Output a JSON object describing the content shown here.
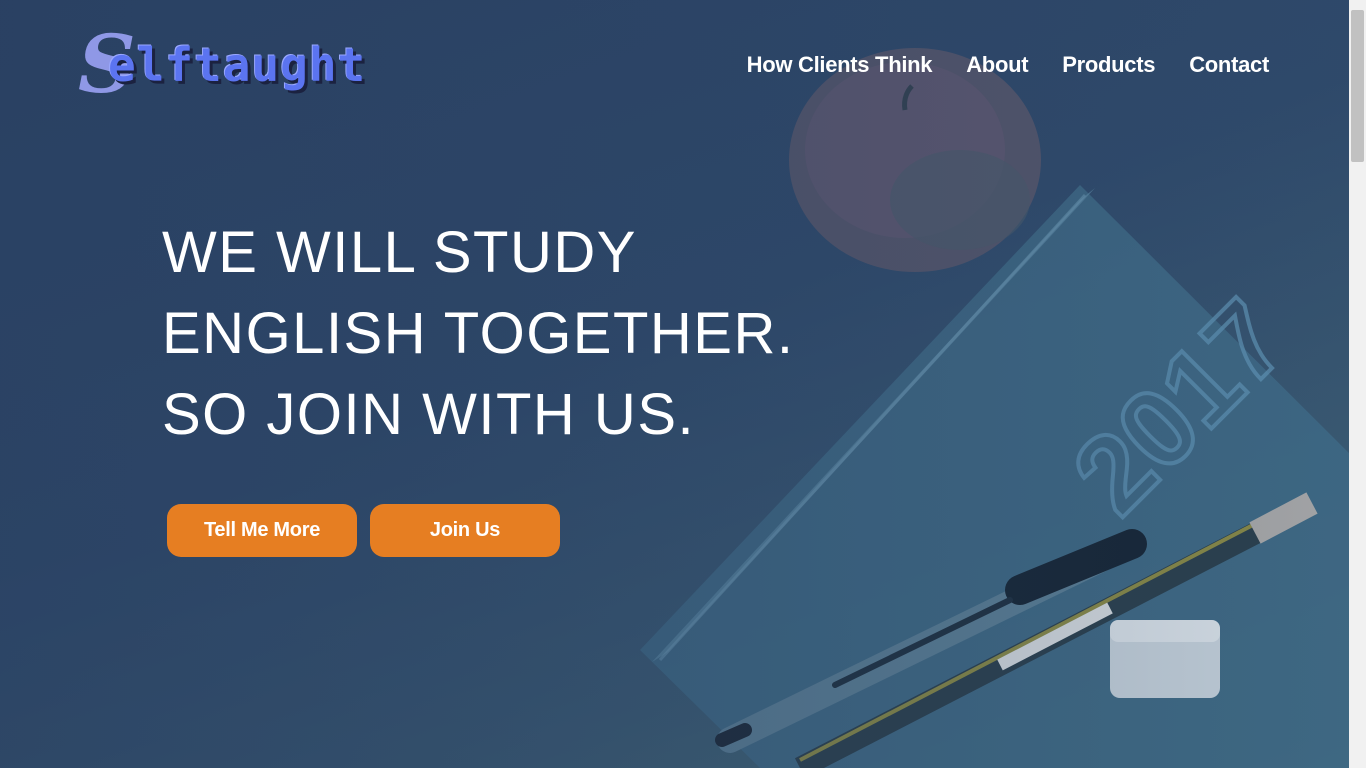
{
  "logo": {
    "initial": "S",
    "text": "elftaught"
  },
  "nav": {
    "items": [
      {
        "label": "How Clients Think"
      },
      {
        "label": "About"
      },
      {
        "label": "Products"
      },
      {
        "label": "Contact"
      }
    ]
  },
  "hero": {
    "headline_lines": [
      "WE WILL STUDY",
      "ENGLISH TOGETHER.",
      "SO JOIN WITH US."
    ],
    "buttons": {
      "primary": "Tell Me More",
      "secondary": "Join Us"
    },
    "notebook_year": "2017"
  },
  "colors": {
    "accent": "#e67e22",
    "logo_blue": "#5b74f0",
    "logo_lavender": "#8f98e6",
    "background": "#2f4a6b"
  }
}
